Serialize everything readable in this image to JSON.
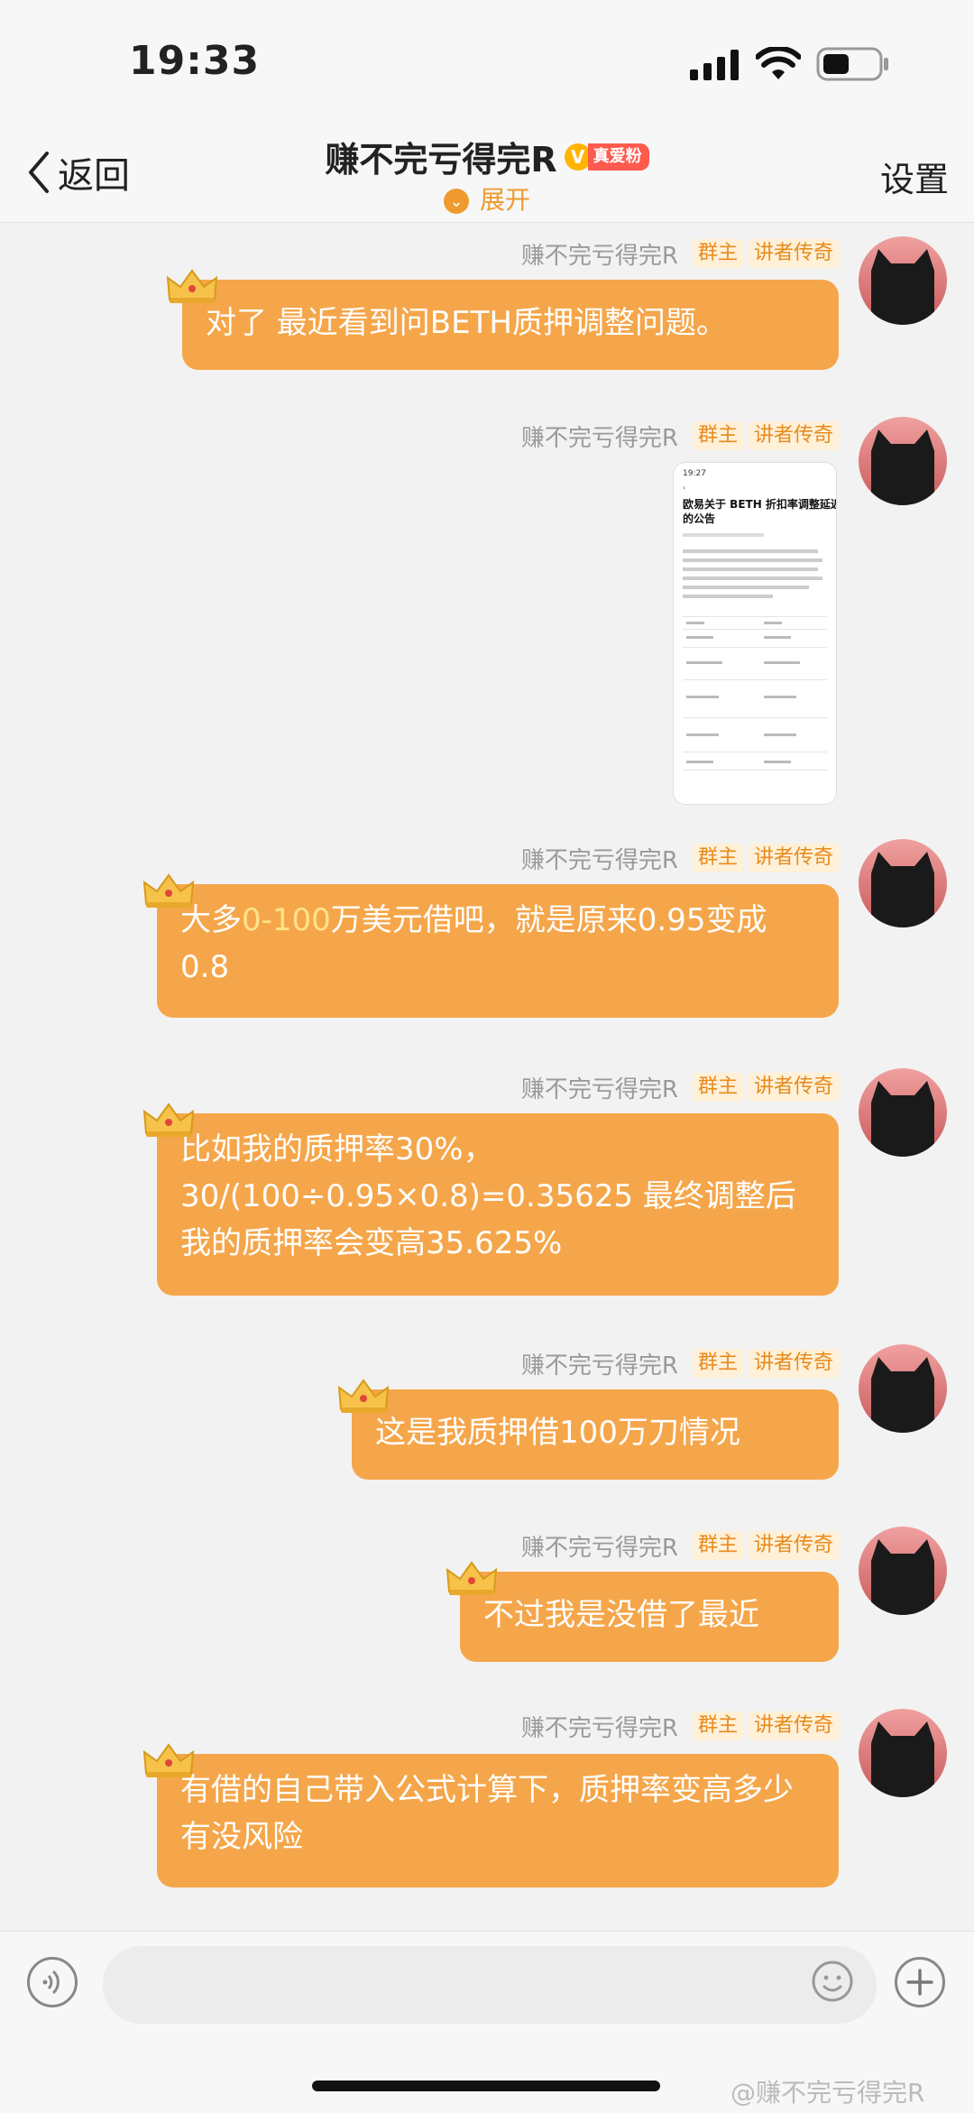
{
  "status": {
    "time": "19:33"
  },
  "nav": {
    "back_label": "返回",
    "title": "赚不完亏得完R",
    "fan_badge_letter": "V",
    "fan_badge": "真爱粉",
    "expand_label": "展开",
    "settings_label": "设置"
  },
  "sender": {
    "name": "赚不完亏得完R",
    "owner_tag": "群主",
    "legend_tag": "讲者传奇"
  },
  "messages": [
    {
      "text": "对了 最近看到问BETH质押调整问题。"
    },
    {
      "image_title": "欧易关于 BETH 折扣率调整延迟的公告",
      "image_time": "19:27"
    },
    {
      "text_pre": "大多",
      "text_hl": "0-100",
      "text_post": "万美元借吧，就是原来0.95变成0.8"
    },
    {
      "text": "比如我的质押率30%，30/(100÷0.95×0.8)=0.35625 最终调整后我的质押率会变高35.625%"
    },
    {
      "text": "这是我质押借100万刀情况"
    },
    {
      "text": "不过我是没借了最近"
    },
    {
      "text": "有借的自己带入公式计算下，质押率变高多少 有没风险"
    }
  ],
  "input": {
    "placeholder": ""
  },
  "watermark": "@赚不完亏得完R",
  "colors": {
    "bubble": "#f5a64a",
    "accent": "#ef9a2e",
    "badge": "#ff5a4e"
  }
}
